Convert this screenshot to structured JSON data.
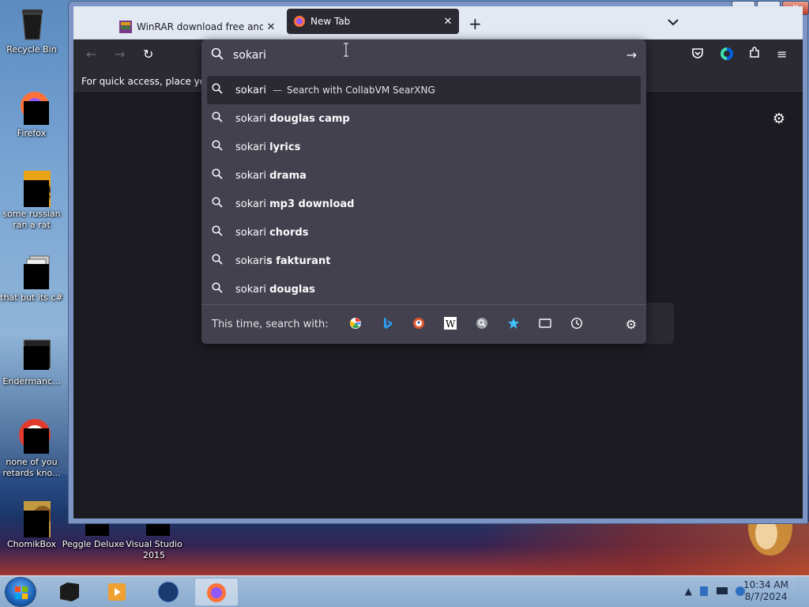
{
  "desktop": {
    "icons": [
      {
        "label": "Recycle Bin"
      },
      {
        "label": "Firefox"
      },
      {
        "label": "some russian ran a rat"
      },
      {
        "label": "that but its c#"
      },
      {
        "label": "Endermanc..."
      },
      {
        "label": "none of you retards kno..."
      },
      {
        "label": "ChomikBox"
      },
      {
        "label": "Peggle Deluxe"
      },
      {
        "label": "Visual Studio 2015"
      }
    ]
  },
  "browser": {
    "tabs": [
      {
        "title": "WinRAR download free and sup",
        "close": "✕"
      },
      {
        "title": "New Tab",
        "close": "✕"
      }
    ],
    "new_tab": "+",
    "bookmarks_hint": "For quick access, place your l",
    "urlbar": {
      "query": "sokari",
      "first_row": {
        "query": "sokari",
        "dash": "—",
        "engine_text": "Search with CollabVM SearXNG"
      },
      "suggestions": [
        {
          "prefix": "sokari ",
          "bold": "douglas camp"
        },
        {
          "prefix": "sokari ",
          "bold": "lyrics"
        },
        {
          "prefix": "sokari ",
          "bold": "drama"
        },
        {
          "prefix": "sokari ",
          "bold": "mp3 download"
        },
        {
          "prefix": "sokari ",
          "bold": "chords"
        },
        {
          "prefix": "sokari",
          "bold": "s fakturant"
        },
        {
          "prefix": "sokari ",
          "bold": "douglas"
        }
      ],
      "one_time_label": "This time, search with:",
      "engines": [
        "google-icon",
        "bing-icon",
        "duckduckgo-icon",
        "wikipedia-icon",
        "searxng-icon",
        "bookmarks-icon",
        "tabs-icon",
        "history-icon"
      ]
    }
  },
  "taskbar": {
    "time": "10:34 AM",
    "date": "8/7/2024"
  },
  "colors": {
    "urlbar_bg": "#42414d",
    "toolbar_bg": "#2b2a33",
    "content_bg": "#1c1b22",
    "accent": "#0060df"
  }
}
